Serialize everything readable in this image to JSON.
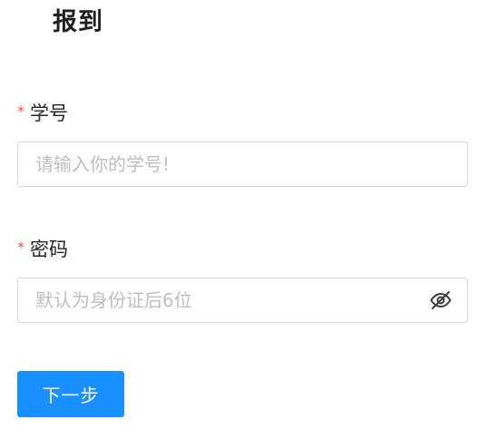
{
  "page": {
    "title": "报到"
  },
  "form": {
    "student_id": {
      "required_mark": "*",
      "label": "学号",
      "value": "",
      "placeholder": "请输入你的学号!"
    },
    "password": {
      "required_mark": "*",
      "label": "密码",
      "value": "",
      "placeholder": "默认为身份证后6位",
      "toggle_icon": "eye-invisible-icon"
    },
    "submit_label": "下一步"
  },
  "colors": {
    "primary": "#1890ff",
    "required": "#ff4d4f",
    "placeholder": "#bfbfbf",
    "border": "#d9d9d9"
  }
}
